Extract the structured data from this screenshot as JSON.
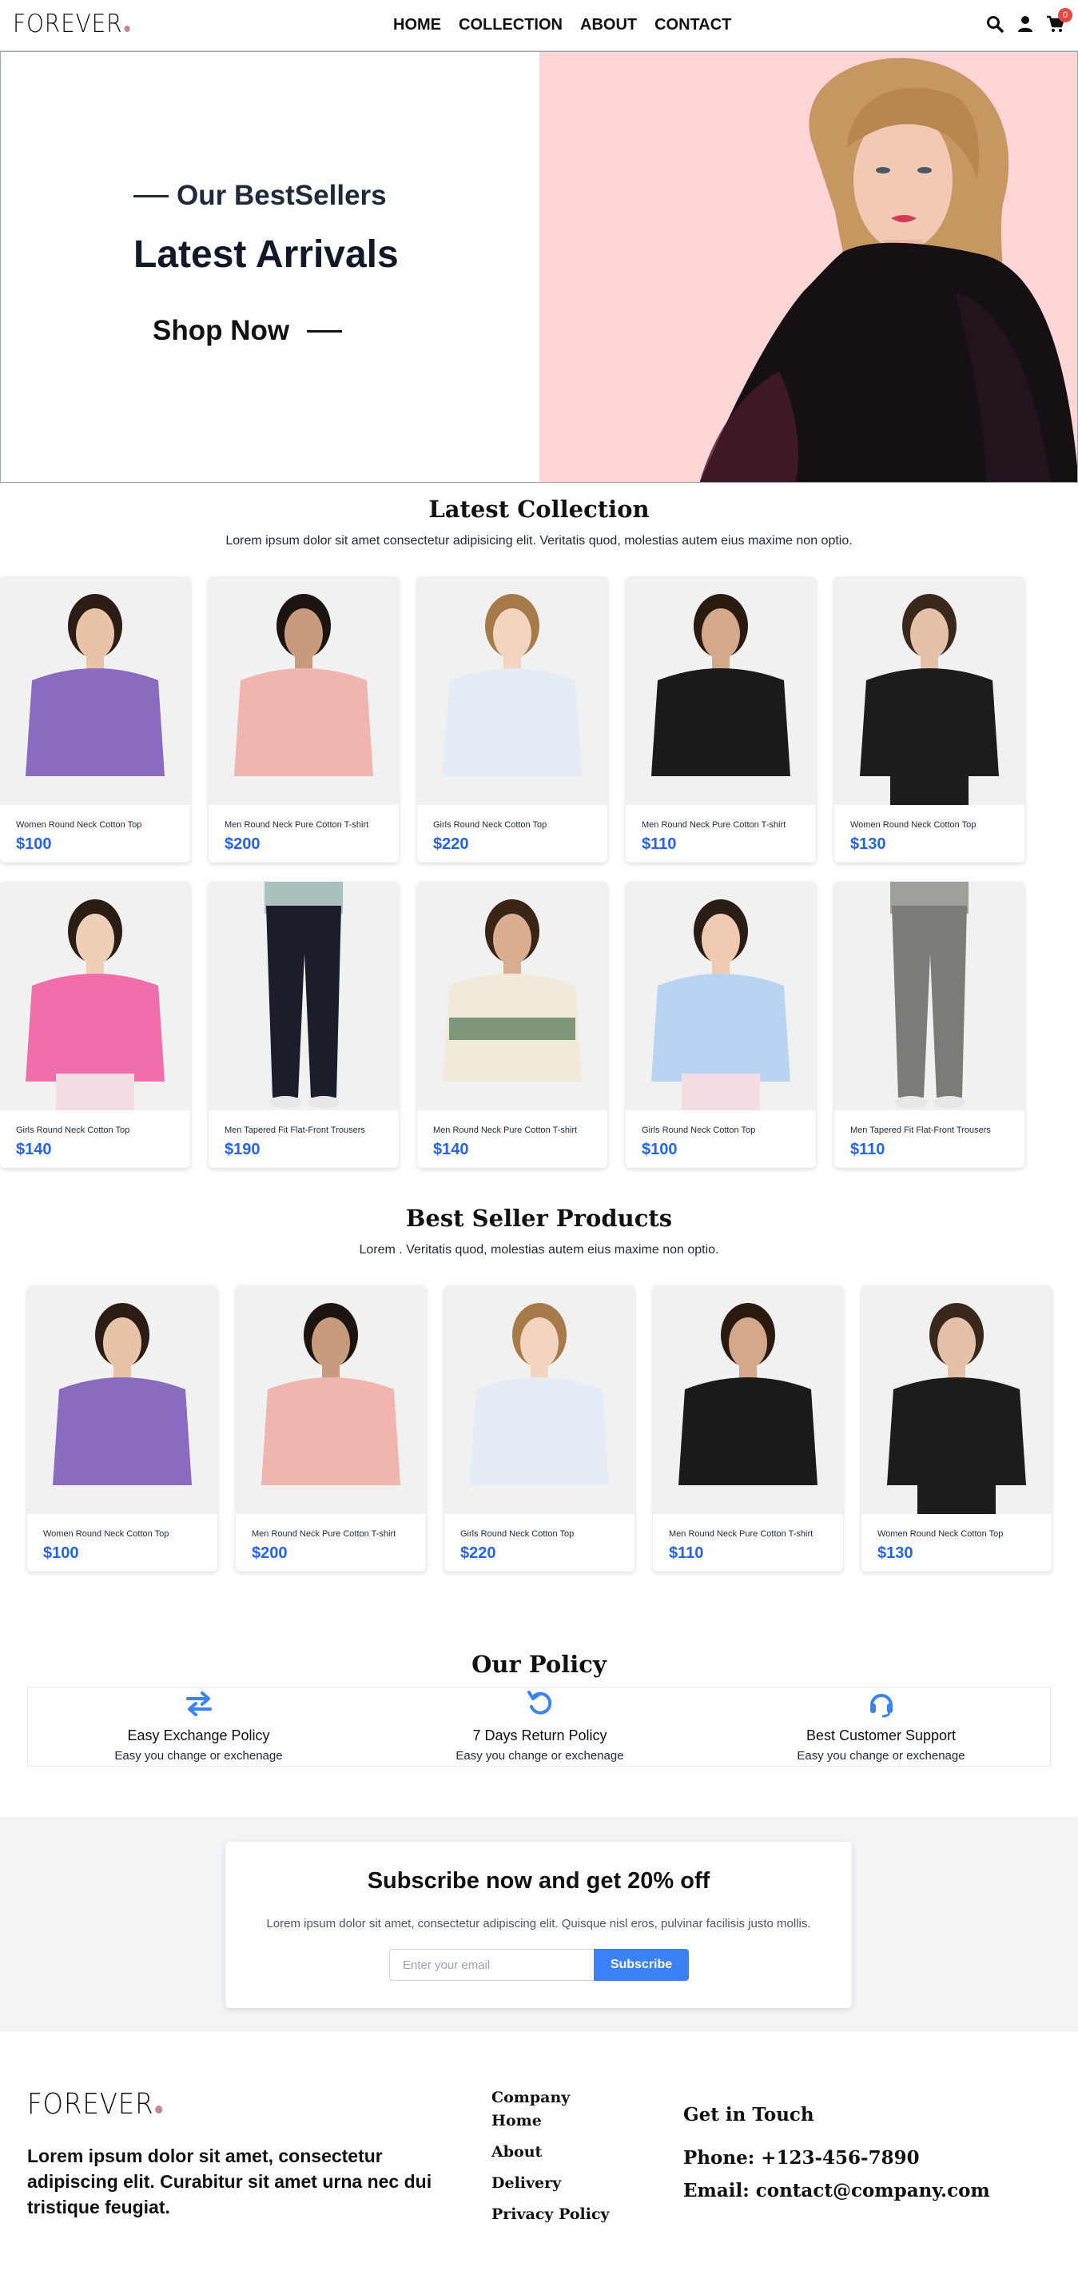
{
  "brand": {
    "logo_text": "FOREVER",
    "accent_dot_color": "#c586a0"
  },
  "nav": {
    "links": [
      "HOME",
      "COLLECTION",
      "ABOUT",
      "CONTACT"
    ],
    "icons": [
      "search-icon",
      "user-icon",
      "cart-icon"
    ],
    "cart_count": "0"
  },
  "hero": {
    "subtitle": "Our BestSellers",
    "title": "Latest Arrivals",
    "cta": "Shop Now",
    "background_color": "#fdd5d6"
  },
  "latest": {
    "title": "Latest Collection",
    "subtitle": "Lorem ipsum dolor sit amet consectetur adipisicing elit. Veritatis quod, molestias autem eius maxime non optio.",
    "products": [
      {
        "name": "Women Round Neck Cotton Top",
        "price": "$100"
      },
      {
        "name": "Men Round Neck Pure Cotton T-shirt",
        "price": "$200"
      },
      {
        "name": "Girls Round Neck Cotton Top",
        "price": "$220"
      },
      {
        "name": "Men Round Neck Pure Cotton T-shirt",
        "price": "$110"
      },
      {
        "name": "Women Round Neck Cotton Top",
        "price": "$130"
      },
      {
        "name": "Girls Round Neck Cotton Top",
        "price": "$140"
      },
      {
        "name": "Men Tapered Fit Flat-Front Trousers",
        "price": "$190"
      },
      {
        "name": "Men Round Neck Pure Cotton T-shirt",
        "price": "$140"
      },
      {
        "name": "Girls Round Neck Cotton Top",
        "price": "$100"
      },
      {
        "name": "Men Tapered Fit Flat-Front Trousers",
        "price": "$110"
      }
    ]
  },
  "bestseller": {
    "title": "Best Seller Products",
    "subtitle": "Lorem . Veritatis quod, molestias autem eius maxime non optio.",
    "products": [
      {
        "name": "Women Round Neck Cotton Top",
        "price": "$100"
      },
      {
        "name": "Men Round Neck Pure Cotton T-shirt",
        "price": "$200"
      },
      {
        "name": "Girls Round Neck Cotton Top",
        "price": "$220"
      },
      {
        "name": "Men Round Neck Pure Cotton T-shirt",
        "price": "$110"
      },
      {
        "name": "Women Round Neck Cotton Top",
        "price": "$130"
      }
    ]
  },
  "policy": {
    "title": "Our Policy",
    "items": [
      {
        "icon": "exchange-icon",
        "title": "Easy Exchange Policy",
        "desc": "Easy you change or exchenage"
      },
      {
        "icon": "return-icon",
        "title": "7 Days Return Policy",
        "desc": "Easy you change or exchenage"
      },
      {
        "icon": "headset-icon",
        "title": "Best Customer Support",
        "desc": "Easy you change or exchenage"
      }
    ],
    "icon_color": "#3b82f6"
  },
  "subscribe": {
    "title": "Subscribe now and get 20% off",
    "desc": "Lorem ipsum dolor sit amet, consectetur adipiscing elit. Quisque nisl eros, pulvinar facilisis justo mollis.",
    "placeholder": "Enter your email",
    "button": "Subscribe",
    "button_color": "#3b82f6"
  },
  "footer": {
    "logo_text": "FOREVER",
    "description": "Lorem ipsum dolor sit amet, consectetur adipiscing elit. Curabitur sit amet urna nec dui tristique feugiat.",
    "links": [
      "Company",
      "Home",
      "About",
      "Delivery",
      "Privacy Policy"
    ],
    "contact_title": "Get in Touch",
    "phone": "Phone: +123-456-7890",
    "email": "Email: contact@company.com"
  },
  "accent_price_color": "#2563eb"
}
